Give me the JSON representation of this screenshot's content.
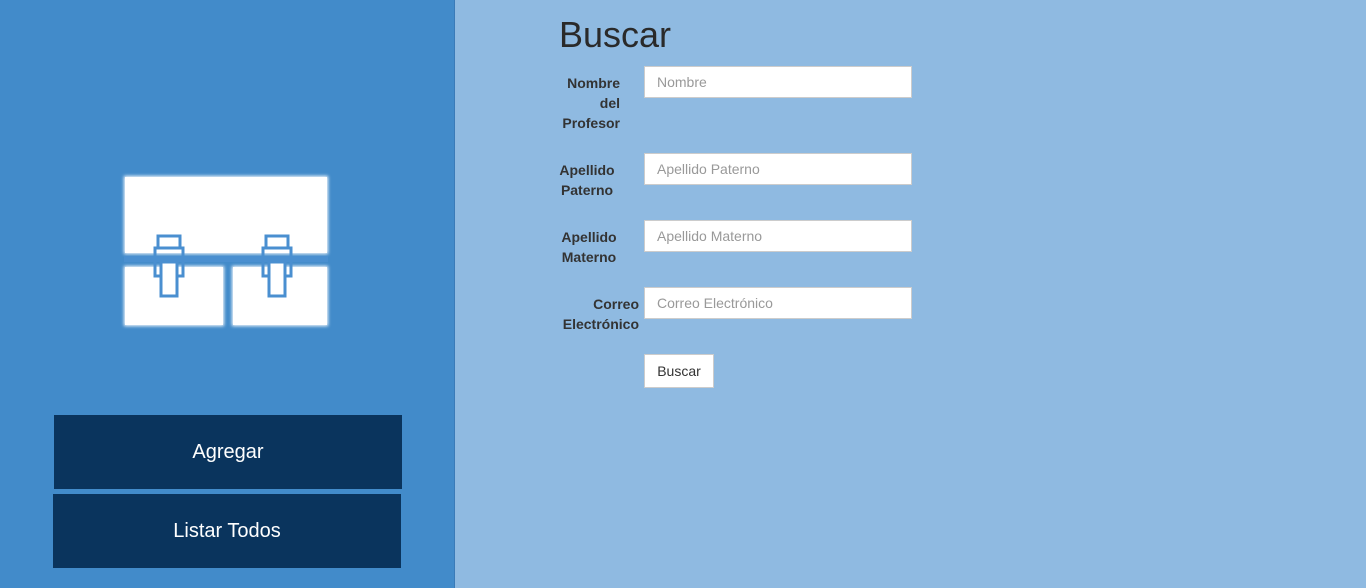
{
  "sidebar": {
    "logo_icon": "briefcase-icon",
    "buttons": [
      {
        "label": "Agregar"
      },
      {
        "label": "Listar Todos"
      }
    ]
  },
  "search_form": {
    "title": "Buscar",
    "fields": [
      {
        "label_lines": [
          "Nombre",
          "del",
          "Profesor"
        ],
        "placeholder": "Nombre",
        "value": ""
      },
      {
        "label_lines": [
          "Apellido",
          "Paterno"
        ],
        "placeholder": "Apellido Paterno",
        "value": ""
      },
      {
        "label_lines": [
          "Apellido",
          "Materno"
        ],
        "placeholder": "Apellido Materno",
        "value": ""
      },
      {
        "label_lines": [
          "Correo",
          "Electrónico"
        ],
        "placeholder": "Correo Electrónico",
        "value": ""
      }
    ],
    "submit_label": "Buscar"
  },
  "colors": {
    "sidebar_bg": "#428bca",
    "main_bg": "#8fbae1",
    "sidebar_button_bg": "#0a345d",
    "logo_accent": "#4a8fd0"
  }
}
